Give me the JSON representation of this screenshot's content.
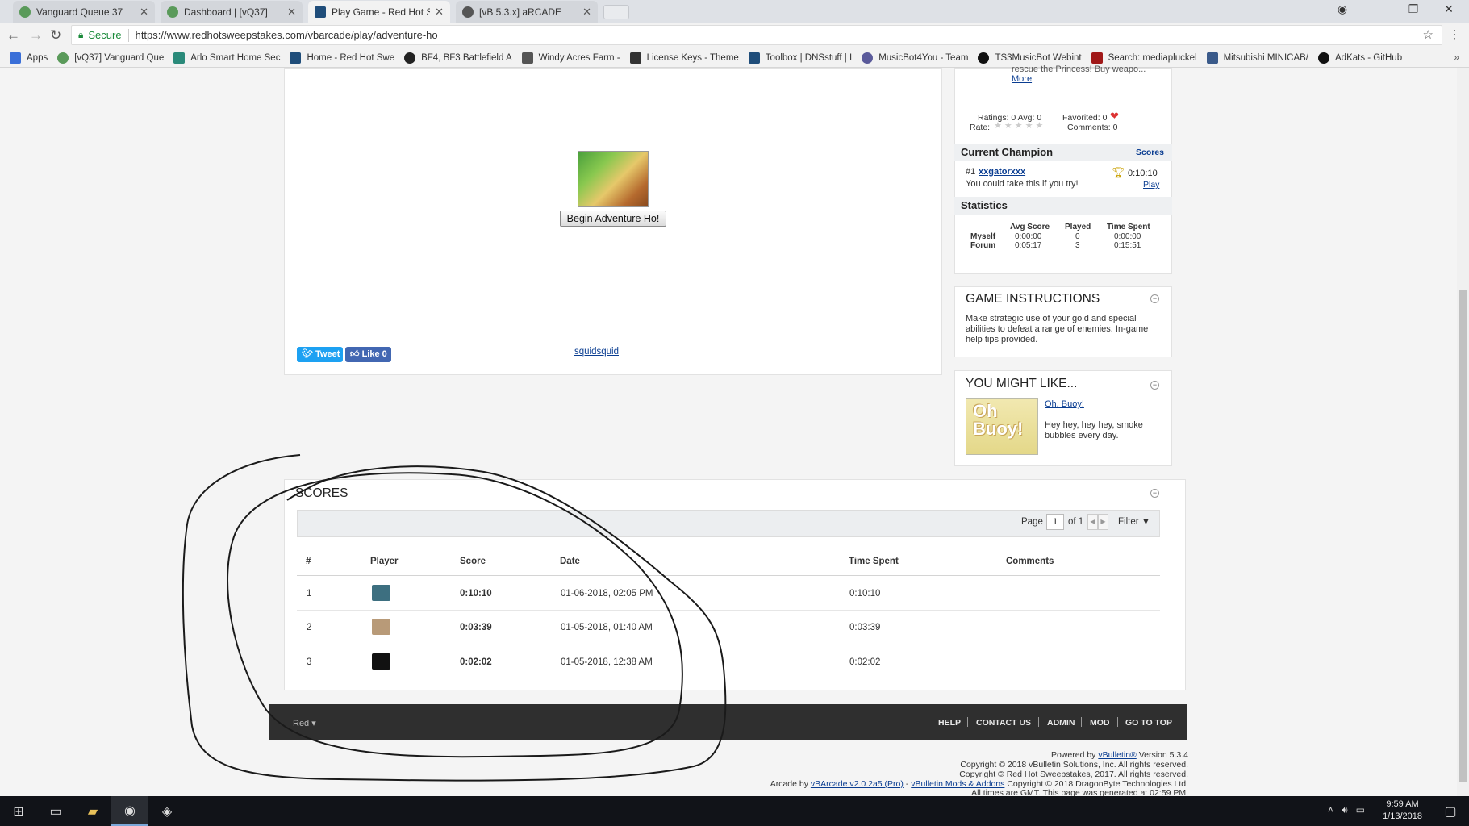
{
  "browser": {
    "tabs": [
      {
        "title": "Vanguard Queue 37"
      },
      {
        "title": "Dashboard | [vQ37]"
      },
      {
        "title": "Play Game - Red Hot Sw"
      },
      {
        "title": "[vB 5.3.x] aRCADE"
      }
    ],
    "secure_label": "Secure",
    "url": "https://www.redhotsweepstakes.com/vbarcade/play/adventure-ho",
    "bookmarks": [
      "Apps",
      "[vQ37] Vanguard Que",
      "Arlo Smart Home Sec",
      "Home - Red Hot Swe",
      "BF4, BF3 Battlefield A",
      "Windy Acres Farm -",
      "License Keys - Theme",
      "Toolbox | DNSstuff | I",
      "MusicBot4You - Team",
      "TS3MusicBot Webint",
      "Search: mediapluckel",
      "Mitsubishi MINICAB/",
      "AdKats - GitHub"
    ],
    "more_bookmarks": "»"
  },
  "game": {
    "begin_button": "Begin Adventure Ho!",
    "tweet": "Tweet",
    "like": "Like 0",
    "author": "squidsquid"
  },
  "info": {
    "desc_fragment": "rescue the Princess! Buy weapo...",
    "more": "More",
    "ratings": "Ratings: 0 Avg: 0",
    "rate": "Rate:",
    "favorited": "Favorited: 0",
    "comments": "Comments: 0"
  },
  "champion": {
    "heading": "Current Champion",
    "scores_link": "Scores",
    "rank": "#1",
    "name": "xxgatorxxx",
    "time": "0:10:10",
    "tagline": "You could take this if you try!",
    "play_link": "Play"
  },
  "statistics": {
    "heading": "Statistics",
    "columns": [
      "Avg Score",
      "Played",
      "Time Spent"
    ],
    "rows": [
      {
        "label": "Myself",
        "avg": "0:00:00",
        "played": "0",
        "time": "0:00:00"
      },
      {
        "label": "Forum",
        "avg": "0:05:17",
        "played": "3",
        "time": "0:15:51"
      }
    ]
  },
  "instructions": {
    "title": "GAME INSTRUCTIONS",
    "text": "Make strategic use of your gold and special abilities to defeat a range of enemies. In-game help tips provided."
  },
  "might_like": {
    "title": "YOU MIGHT LIKE...",
    "game_name": "Oh, Buoy!",
    "thumb_text": "Oh Buoy!",
    "desc": "Hey hey, hey hey, smoke bubbles every day."
  },
  "scores": {
    "title": "SCORES",
    "page_label": "Page",
    "page": "1",
    "of_label": "of 1",
    "filter": "Filter",
    "columns": [
      "#",
      "Player",
      "Score",
      "Date",
      "Time Spent",
      "Comments"
    ],
    "rows": [
      {
        "rank": "1",
        "score": "0:10:10",
        "date": "01-06-2018, 02:05 PM",
        "time": "0:10:10",
        "avatar_color": "#3d6f80"
      },
      {
        "rank": "2",
        "score": "0:03:39",
        "date": "01-05-2018, 01:40 AM",
        "time": "0:03:39",
        "avatar_color": "#b89a78"
      },
      {
        "rank": "3",
        "score": "0:02:02",
        "date": "01-05-2018, 12:38 AM",
        "time": "0:02:02",
        "avatar_color": "#111111"
      }
    ]
  },
  "footer": {
    "style_select": "Red",
    "links": [
      "HELP",
      "CONTACT US",
      "ADMIN",
      "MOD",
      "GO TO TOP"
    ],
    "powered_prefix": "Powered by",
    "powered_link": "vBulletin®",
    "powered_suffix": "Version 5.3.4",
    "copyright1": "Copyright © 2018 vBulletin Solutions, Inc. All rights reserved.",
    "copyright2": "Copyright © Red Hot Sweepstakes, 2017. All rights reserved.",
    "arcade_prefix": "Arcade by",
    "arcade_link1": "vBArcade v2.0.2a5 (Pro)",
    "arcade_dash": "-",
    "arcade_link2": "vBulletin Mods & Addons",
    "arcade_suffix": "Copyright © 2018 DragonByte Technologies Ltd.",
    "times": "All times are GMT. This page was generated at 02:59 PM."
  },
  "taskbar": {
    "time": "9:59 AM",
    "date": "1/13/2018"
  }
}
